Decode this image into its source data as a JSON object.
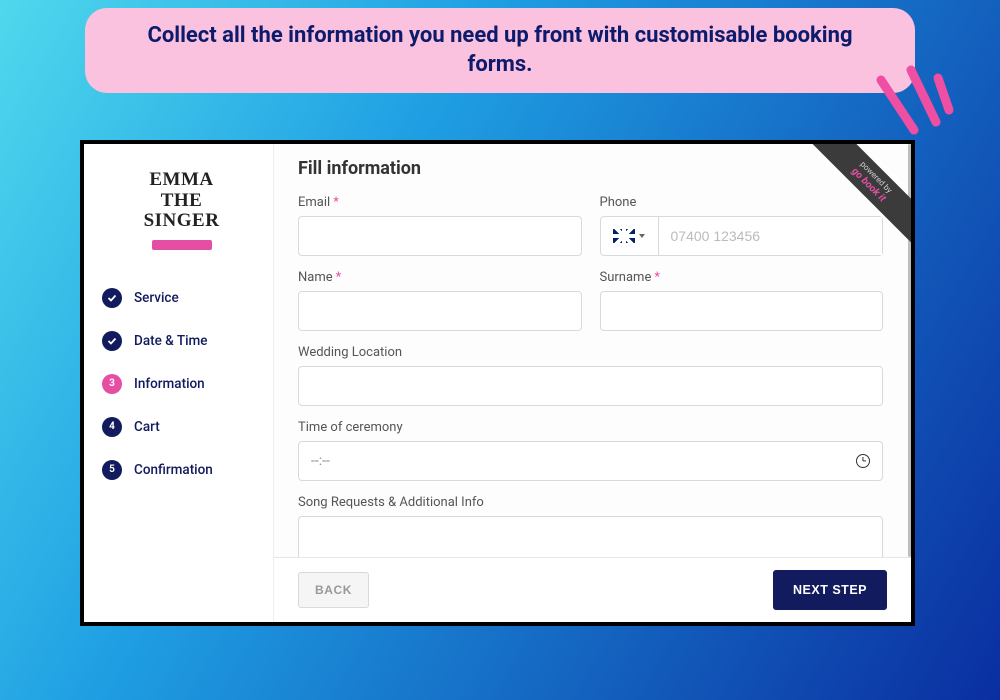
{
  "caption": "Collect all the information you need up front with customisable booking forms.",
  "logo": {
    "line1": "EMMA",
    "line2": "THE",
    "line3": "SINGER"
  },
  "ribbon": {
    "line1": "powered by",
    "line2": "go book it"
  },
  "steps": [
    {
      "label": "Service",
      "state": "done",
      "num": ""
    },
    {
      "label": "Date & Time",
      "state": "done",
      "num": ""
    },
    {
      "label": "Information",
      "state": "active",
      "num": "3"
    },
    {
      "label": "Cart",
      "state": "pending",
      "num": "4"
    },
    {
      "label": "Confirmation",
      "state": "pending",
      "num": "5"
    }
  ],
  "form": {
    "title": "Fill information",
    "email_label": "Email",
    "phone_label": "Phone",
    "phone_placeholder": "07400 123456",
    "name_label": "Name",
    "surname_label": "Surname",
    "wedding_location_label": "Wedding Location",
    "time_label": "Time of ceremony",
    "time_placeholder": "--:--",
    "song_label": "Song Requests & Additional Info",
    "required": "*"
  },
  "buttons": {
    "back": "BACK",
    "next": "NEXT STEP"
  }
}
